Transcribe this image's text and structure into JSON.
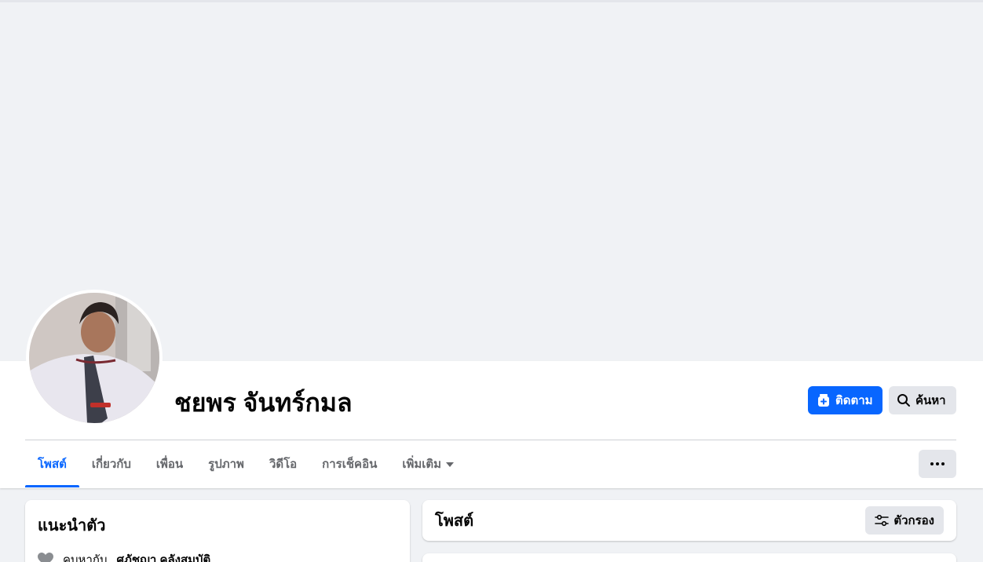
{
  "profile": {
    "name": "ชยพร จันทร์กมล"
  },
  "actions": {
    "follow_label": "ติดตาม",
    "search_label": "ค้นหา"
  },
  "tabs": [
    {
      "label": "โพสต์",
      "active": true
    },
    {
      "label": "เกี่ยวกับ",
      "active": false
    },
    {
      "label": "เพื่อน",
      "active": false
    },
    {
      "label": "รูปภาพ",
      "active": false
    },
    {
      "label": "วิดีโอ",
      "active": false
    },
    {
      "label": "การเช็คอิน",
      "active": false
    },
    {
      "label": "เพิ่มเติม",
      "active": false
    }
  ],
  "intro": {
    "title": "แนะนำตัว",
    "relationship_prefix": "คบหากับ",
    "relationship_partner": "ศุภัชญา คลังสมบัติ"
  },
  "posts": {
    "title": "โพสต์",
    "filter_label": "ตัวกรอง"
  },
  "colors": {
    "accent": "#0866ff",
    "background": "#f0f2f5",
    "secondary_button": "#e4e6eb"
  },
  "icons": {
    "follow": "follow-plus-icon",
    "search": "search-icon",
    "more": "more-dots-icon",
    "dropdown": "caret-down-icon",
    "relationship": "heart-icon",
    "filter": "filter-sliders-icon"
  }
}
